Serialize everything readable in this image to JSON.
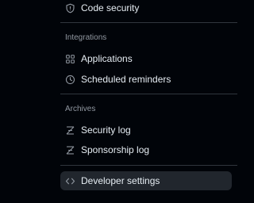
{
  "nav": {
    "code_security": {
      "label": "Code security",
      "icon": "shield-icon"
    },
    "integrations": {
      "heading": "Integrations",
      "items": [
        {
          "label": "Applications",
          "icon": "apps-icon"
        },
        {
          "label": "Scheduled reminders",
          "icon": "clock-icon"
        }
      ]
    },
    "archives": {
      "heading": "Archives",
      "items": [
        {
          "label": "Security log",
          "icon": "log-icon"
        },
        {
          "label": "Sponsorship log",
          "icon": "log-icon"
        }
      ]
    },
    "developer_settings": {
      "label": "Developer settings",
      "icon": "code-icon",
      "active": true
    }
  },
  "colors": {
    "background": "#010409",
    "text": "#e6edf3",
    "muted": "#9198a1",
    "divider": "#30363d",
    "active_bg": "#21262d"
  }
}
